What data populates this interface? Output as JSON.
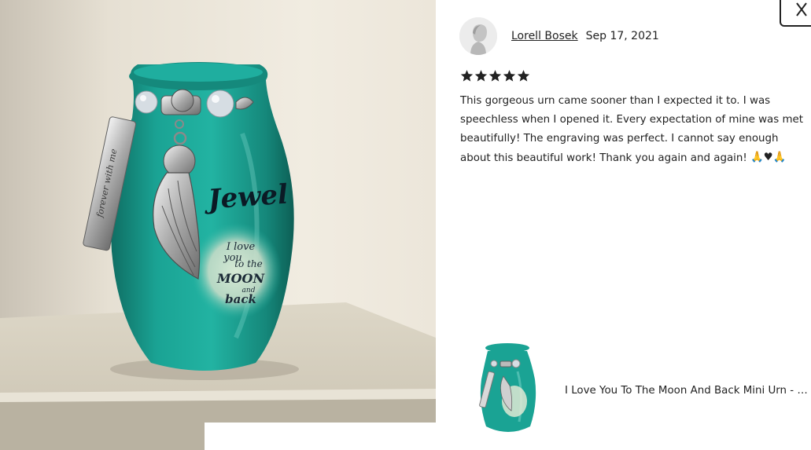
{
  "photo": {
    "engraving_name": "Jewel",
    "engraving_quote": [
      "I love",
      "you",
      "to the",
      "MOON",
      "and",
      "back"
    ],
    "tag_text": "forever with me"
  },
  "review": {
    "reviewer_name": "Lorell Bosek",
    "date": "Sep 17, 2021",
    "rating": 5,
    "rating_max": 5,
    "text": "This gorgeous urn came sooner than I expected it to. I was speechless when I opened it. Every expectation of mine was met beautifully! The engraving was perfect. I cannot say enough about this beautiful work! Thank you again and again!",
    "emoji_suffix": "🙏♥🙏"
  },
  "product": {
    "title": "I Love You To The Moon And Back Mini Urn - Love Urn - Wings Charm"
  },
  "icons": {
    "close": "close-icon",
    "star": "star-icon",
    "avatar": "user-avatar-icon"
  },
  "colors": {
    "urn_teal": "#1a9c8e",
    "text": "#222222",
    "star": "#222222"
  }
}
